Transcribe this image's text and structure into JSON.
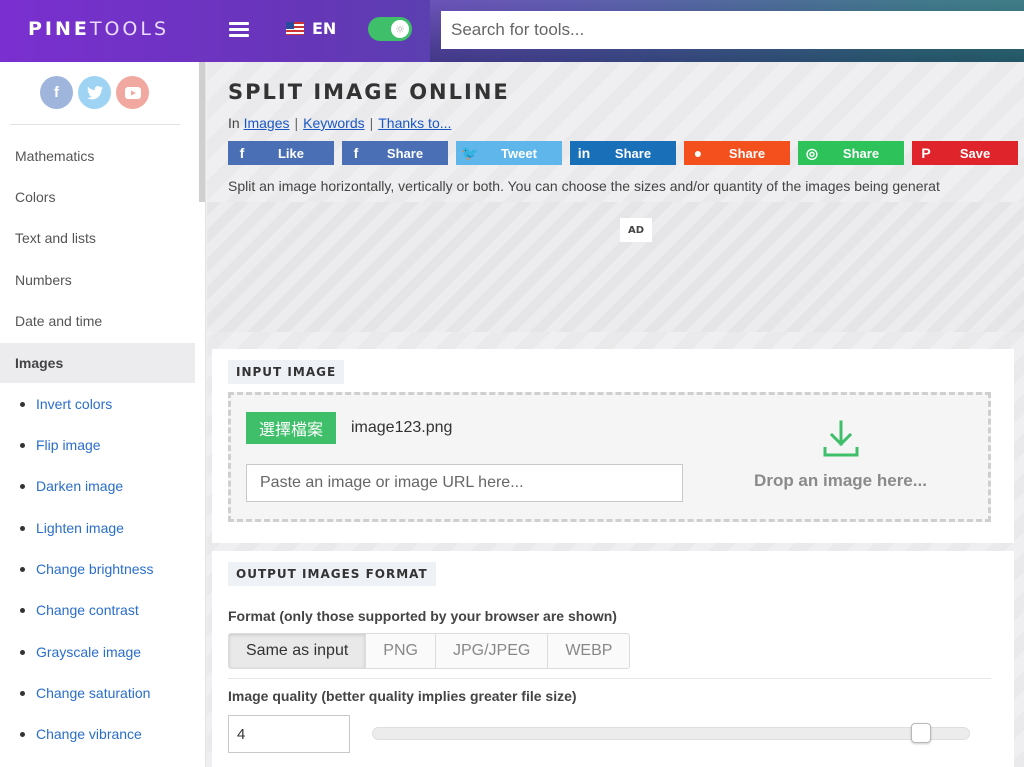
{
  "header": {
    "logo_pine": "PINE",
    "logo_tools": "TOOLS",
    "language": "EN",
    "search_placeholder": "Search for tools..."
  },
  "sidebar": {
    "social": [
      {
        "name": "facebook",
        "glyph": "f"
      },
      {
        "name": "twitter",
        "glyph": "t"
      },
      {
        "name": "youtube",
        "glyph": "▶"
      }
    ],
    "categories": {
      "mathematics": "Mathematics",
      "colors": "Colors",
      "text_and_lists": "Text and lists",
      "numbers": "Numbers",
      "date_and_time": "Date and time",
      "images": "Images"
    },
    "image_tools": [
      "Invert colors",
      "Flip image",
      "Darken image",
      "Lighten image",
      "Change brightness",
      "Change contrast",
      "Grayscale image",
      "Change saturation",
      "Change vibrance"
    ]
  },
  "page": {
    "title": "SPLIT IMAGE ONLINE",
    "crumb_in": "In",
    "crumb_images": "Images",
    "crumb_keywords": "Keywords",
    "crumb_thanks": "Thanks to...",
    "crumb_sep": "|",
    "description": "Split an image horizontally, vertically or both. You can choose the sizes and/or quantity of the images being generat",
    "ad_label": "AD"
  },
  "share_buttons": [
    {
      "label": "Like",
      "icon": "facebook-icon",
      "glyph": "f",
      "color": "#4a6fb5"
    },
    {
      "label": "Share",
      "icon": "facebook-icon",
      "glyph": "f",
      "color": "#4a6fb5"
    },
    {
      "label": "Tweet",
      "icon": "twitter-icon",
      "glyph": "🐦",
      "color": "#5fb6ea"
    },
    {
      "label": "Share",
      "icon": "linkedin-icon",
      "glyph": "in",
      "color": "#1a6fb9"
    },
    {
      "label": "Share",
      "icon": "reddit-icon",
      "glyph": "●",
      "color": "#f4501e"
    },
    {
      "label": "Share",
      "icon": "whatsapp-icon",
      "glyph": "◎",
      "color": "#2ec35a"
    },
    {
      "label": "Save",
      "icon": "pinterest-icon",
      "glyph": "P",
      "color": "#e0242c"
    }
  ],
  "input_section": {
    "title": "INPUT IMAGE",
    "choose_file_label": "選擇檔案",
    "file_name": "image123.png",
    "url_placeholder": "Paste an image or image URL here...",
    "drop_text": "Drop an image here..."
  },
  "output_section": {
    "title": "OUTPUT IMAGES FORMAT",
    "format_label": "Format (only those supported by your browser are shown)",
    "formats": [
      "Same as input",
      "PNG",
      "JPG/JPEG",
      "WEBP"
    ],
    "selected_format": "Same as input",
    "quality_label": "Image quality (better quality implies greater file size)",
    "quality_value": "4",
    "quality_slider_fraction": 0.92
  },
  "colors": {
    "accent_green": "#3fbf6a",
    "link_blue": "#1a57c4",
    "header_purple": "#7a2fd0"
  }
}
